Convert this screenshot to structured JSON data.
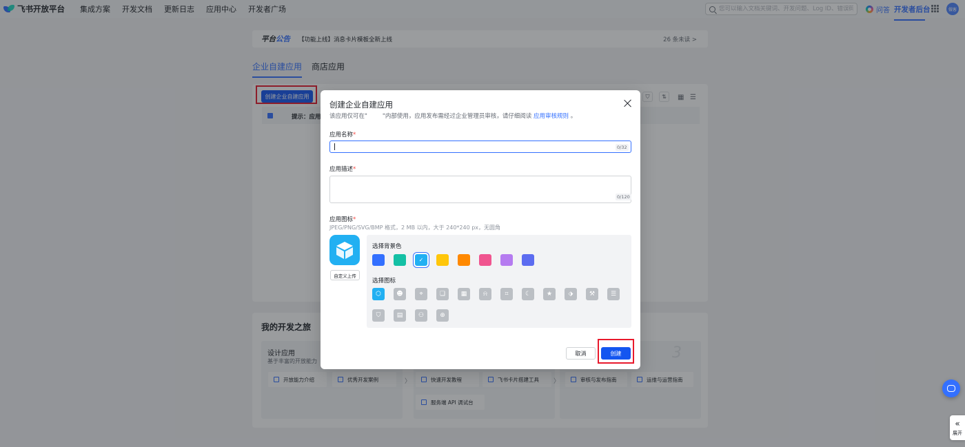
{
  "topnav": {
    "brand": "飞书开放平台",
    "items": [
      "集成方案",
      "开发文档",
      "更新日志",
      "应用中心",
      "开发者广场"
    ],
    "search_placeholder": "您可以输入文档关键词、开发问题、Log ID、错误码",
    "ask_label": "问答",
    "console_label": "开发者后台",
    "avatar_text": "做客"
  },
  "notice": {
    "title_prefix": "平台",
    "title_suffix": "公告",
    "text": "【功能上线】消息卡片模板全新上线",
    "more": "26 条未读 >"
  },
  "tabs": [
    "企业自建应用",
    "商店应用"
  ],
  "list": {
    "create_button": "创建企业自建应用",
    "tip": "提示：应用"
  },
  "journey": {
    "title": "我的开发之旅",
    "design_title": "设计应用",
    "design_sub": "基于丰富的开放能力",
    "links": [
      "开放能力介绍",
      "优秀开发案例",
      "快速开发教程",
      "飞书卡片搭建工具",
      "审核与发布指南",
      "运维与运营指南",
      "服务端 API 调试台"
    ]
  },
  "dialog": {
    "title": "创建企业自建应用",
    "desc_prefix": "该应用仅可在\"",
    "desc_middle": "\"内部使用，应用发布需经过企业管理员审核，请仔细阅读",
    "desc_link": "应用审核规则",
    "desc_suffix": "。",
    "name_label": "应用名称",
    "name_value": "",
    "name_counter": "0/32",
    "desc_label": "应用描述",
    "desc_value": "",
    "desc_counter": "0/120",
    "icon_label": "应用图标",
    "icon_hint": "JPEG/PNG/SVG/BMP 格式，2 MB 以内，大于 240*240 px，无圆角",
    "upload_label": "自定义上传",
    "bg_label": "选择背景色",
    "glyph_label": "选择图标",
    "bg_colors": [
      "#3370ff",
      "#14c0a5",
      "#22b0f2",
      "#ffc60a",
      "#ff8800",
      "#f0548f",
      "#b57bf0",
      "#5c6cf0"
    ],
    "selected_bg_index": 2,
    "glyphs": [
      "cube-icon",
      "robot-icon",
      "pin-icon",
      "book-icon",
      "calendar-icon",
      "bell-icon",
      "chart-icon",
      "moon-icon",
      "star-icon",
      "tag-icon",
      "wrench-icon",
      "doc-icon",
      "shield-icon",
      "layout-icon",
      "people-icon",
      "compass-icon"
    ],
    "selected_glyph_index": 0,
    "cancel_label": "取消",
    "create_label": "创建"
  },
  "float": {
    "expand_label": "展开"
  }
}
